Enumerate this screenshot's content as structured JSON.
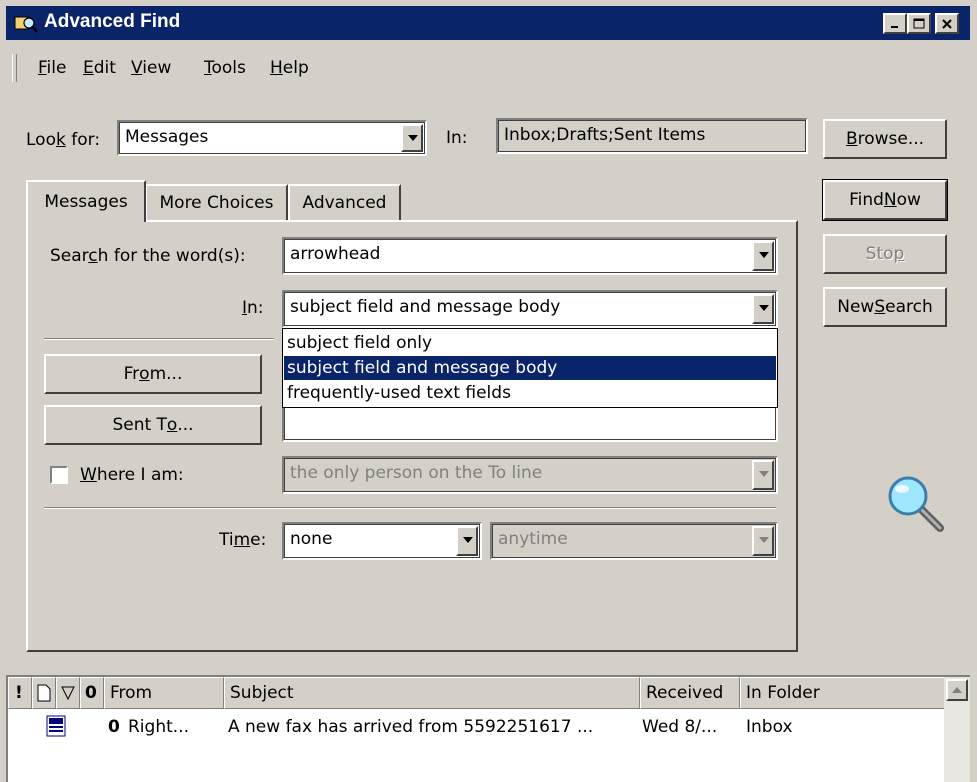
{
  "window": {
    "title": "Advanced Find"
  },
  "menu": [
    {
      "label": "File",
      "u": "F",
      "rest": "ile"
    },
    {
      "label": "Edit",
      "u": "E",
      "rest": "dit"
    },
    {
      "label": "View",
      "u": "V",
      "rest": "iew"
    },
    {
      "label": "Tools",
      "u": "T",
      "rest": "ools"
    },
    {
      "label": "Help",
      "u": "H",
      "rest": "elp"
    }
  ],
  "look_for": {
    "label_pre": "Loo",
    "label_u": "k",
    "label_post": " for:",
    "value": "Messages"
  },
  "in_folder": {
    "label": "In:",
    "value": "Inbox;Drafts;Sent Items"
  },
  "buttons": {
    "browse_pre": "",
    "browse_u": "B",
    "browse_post": "rowse...",
    "find_now_pre": "Find ",
    "find_now_u": "N",
    "find_now_post": "ow",
    "stop_pre": "Sto",
    "stop_u": "p",
    "stop_post": "",
    "new_search_pre": "New ",
    "new_search_u": "S",
    "new_search_post": "earch"
  },
  "tabs": [
    "Messages",
    "More Choices",
    "Advanced"
  ],
  "search": {
    "label_pre": "Sear",
    "label_u": "c",
    "label_post": "h for the word(s):",
    "value": "arrowhead",
    "in_label_u": "I",
    "in_label_post": "n:",
    "in_value": "subject field and message body",
    "options": [
      "subject field only",
      "subject field and message body",
      "frequently-used text fields"
    ]
  },
  "from_button": {
    "pre": "Fr",
    "u": "o",
    "post": "m..."
  },
  "sent_to_button": {
    "pre": "Sent T",
    "u": "o",
    "post": "..."
  },
  "where_i_am": {
    "u": "W",
    "post": "here I am:",
    "value": "the only person on the To line"
  },
  "time": {
    "pre": "Ti",
    "u": "m",
    "post": "e:",
    "value": "none",
    "range": "anytime"
  },
  "results": {
    "columns": [
      "From",
      "Subject",
      "Received",
      "In Folder"
    ],
    "rows": [
      {
        "from": "Right...",
        "subject": "A new fax has arrived from 5592251617 ...",
        "received": "Wed 8/...",
        "folder": "Inbox"
      }
    ]
  }
}
